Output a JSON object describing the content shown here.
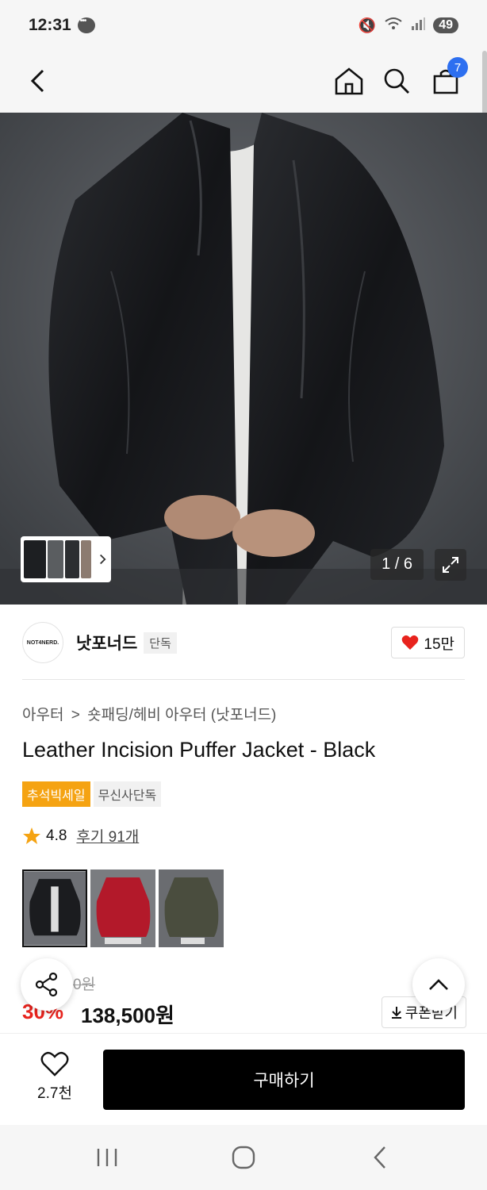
{
  "status_bar": {
    "time": "12:31",
    "battery": "49"
  },
  "nav": {
    "cart_count": "7"
  },
  "gallery": {
    "counter": "1 / 6"
  },
  "brand": {
    "logo_text": "NOT4NERD.",
    "name": "낫포너드",
    "tag": "단독"
  },
  "likes": {
    "count": "15만"
  },
  "breadcrumb": {
    "parent": "아우터",
    "separator": ">",
    "child": "숏패딩/헤비 아우터 (낫포너드)"
  },
  "product": {
    "title": "Leather Incision Puffer Jacket - Black",
    "badge_sale": "추석빅세일",
    "badge_exclusive": "무신사단독",
    "rating": "4.8",
    "reviews": "후기 91개"
  },
  "variants": [
    {
      "name": "Black",
      "color": "#1b1c1f"
    },
    {
      "name": "Red",
      "color": "#b3192a"
    },
    {
      "name": "Khaki",
      "color": "#4a4d3e"
    }
  ],
  "price": {
    "original": "0원",
    "discount": "30%",
    "sale": "138,500원",
    "coupon_label": "쿠폰받기"
  },
  "bottom_bar": {
    "wish_count": "2.7천",
    "buy_label": "구매하기"
  },
  "colors": {
    "accent_blue": "#2d6ff0",
    "sale_red": "#e8231d",
    "badge_orange": "#f5a312"
  }
}
